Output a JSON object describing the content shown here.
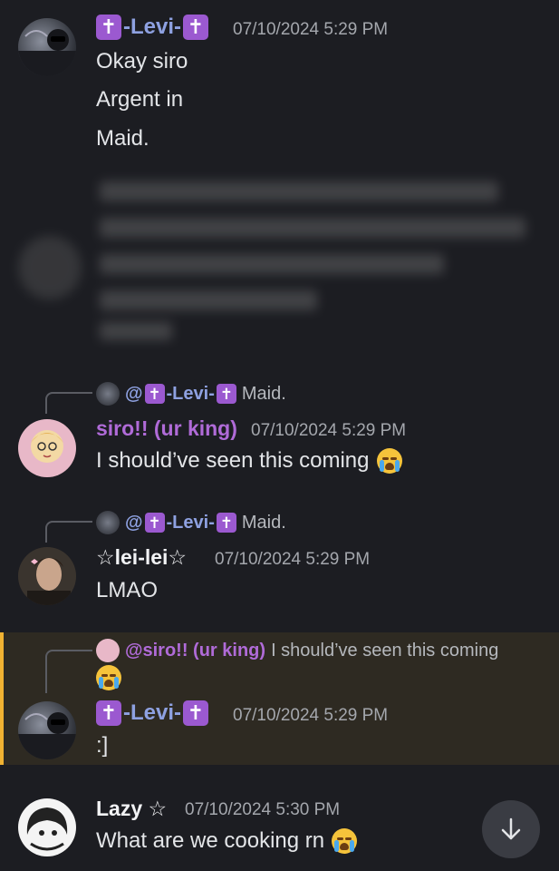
{
  "messages": [
    {
      "author": "-Levi-",
      "timestamp": "07/10/2024 5:29 PM",
      "lines": [
        "Okay siro",
        "Argent in",
        "Maid."
      ]
    },
    {
      "reply_to": {
        "mention": "@",
        "name": "-Levi-",
        "text": "Maid."
      },
      "author": "siro!! (ur king)",
      "timestamp": "07/10/2024 5:29 PM",
      "text": "I should’ve seen this coming"
    },
    {
      "reply_to": {
        "mention": "@",
        "name": "-Levi-",
        "text": "Maid."
      },
      "author": "☆lei-lei☆",
      "timestamp": "07/10/2024 5:29 PM",
      "text": "LMAO"
    },
    {
      "reply_to": {
        "mention": "@siro!! (ur king)",
        "text": "I should’ve seen this coming"
      },
      "author": "-Levi-",
      "timestamp": "07/10/2024 5:29 PM",
      "text": ":]"
    },
    {
      "author": "Lazy ☆",
      "timestamp": "07/10/2024 5:30 PM",
      "text": "What are we cooking rn"
    }
  ],
  "colors": {
    "background": "#1c1d22",
    "levi_name": "#8ea1e1",
    "siro_name": "#b06bd8",
    "highlight_bar": "#f0b232",
    "timestamp": "#a4a7ad"
  },
  "icons": {
    "cross": "✝",
    "scroll": "arrow-down-icon",
    "emoji": "loudly-crying-face"
  }
}
